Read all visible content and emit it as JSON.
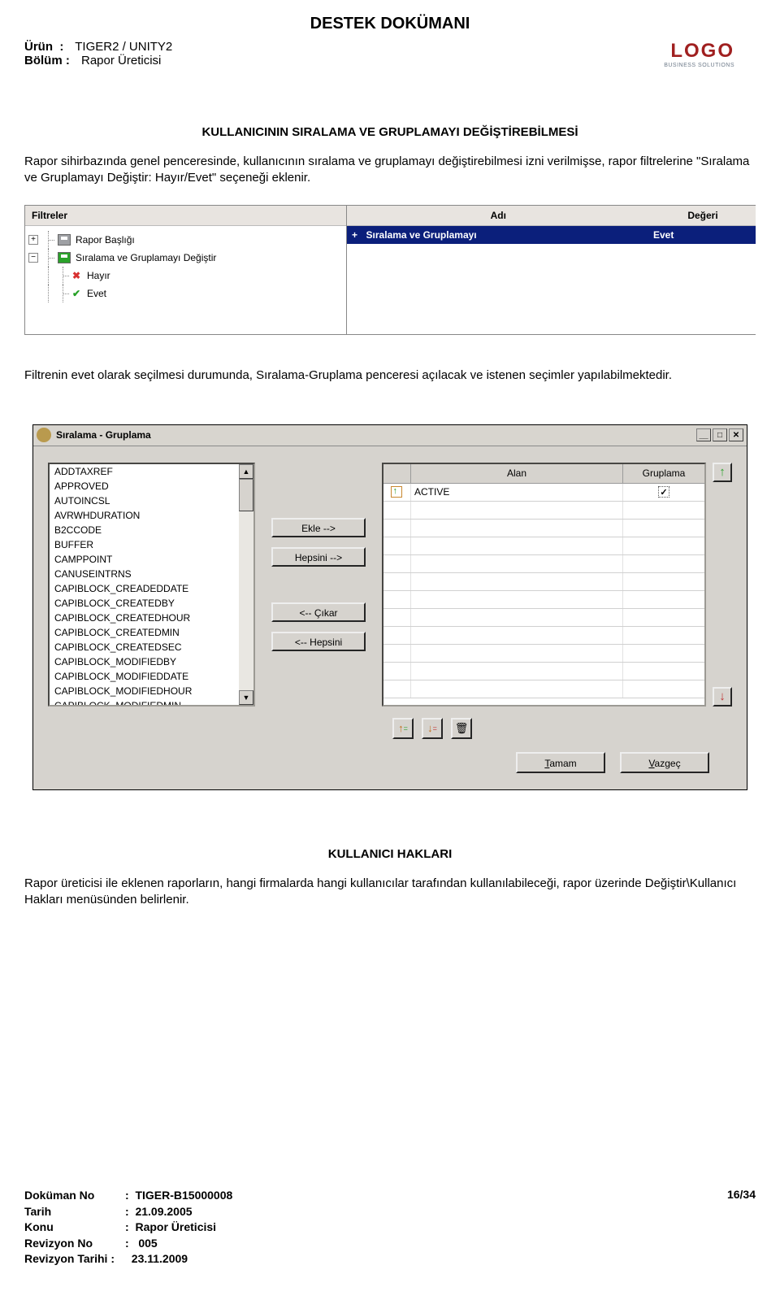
{
  "doc": {
    "title": "DESTEK DOKÜMANI",
    "product_label": "Ürün",
    "product_value": "TIGER2 / UNITY2",
    "section_label": "Bölüm :",
    "section_value": "Rapor Üreticisi",
    "logo": "LOGO",
    "logo_sub": "BUSINESS SOLUTIONS",
    "heading1": "KULLANICININ SIRALAMA VE GRUPLAMAYI DEĞİŞTİREBİLMESİ",
    "para1": "Rapor sihirbazında genel penceresinde, kullanıcının sıralama ve gruplamayı değiştirebilmesi izni verilmişse, rapor filtrelerine \"Sıralama ve Gruplamayı Değiştir: Hayır/Evet\" seçeneği eklenir.",
    "para2": "Filtrenin evet olarak seçilmesi durumunda, Sıralama-Gruplama penceresi açılacak ve istenen seçimler yapılabilmektedir.",
    "heading2": "KULLANICI HAKLARI",
    "para3": "Rapor üreticisi ile eklenen raporların, hangi firmalarda hangi kullanıcılar tarafından kullanılabileceği, rapor üzerinde Değiştir\\Kullanıcı Hakları menüsünden belirlenir."
  },
  "filter": {
    "left_header": "Filtreler",
    "right_header_name": "Adı",
    "right_header_value": "Değeri",
    "tree": {
      "item1": "Rapor Başlığı",
      "item2": "Sıralama ve Gruplamayı Değiştir",
      "opt_no": "Hayır",
      "opt_yes": "Evet"
    },
    "selected": {
      "name": "Sıralama ve Gruplamayı",
      "value": "Evet",
      "plus": "+"
    }
  },
  "dialog": {
    "title": "Sıralama - Gruplama",
    "fields": [
      "ADDTAXREF",
      "APPROVED",
      "AUTOINCSL",
      "AVRWHDURATION",
      "B2CCODE",
      "BUFFER",
      "CAMPPOINT",
      "CANUSEINTRNS",
      "CAPIBLOCK_CREADEDDATE",
      "CAPIBLOCK_CREATEDBY",
      "CAPIBLOCK_CREATEDHOUR",
      "CAPIBLOCK_CREATEDMIN",
      "CAPIBLOCK_CREATEDSEC",
      "CAPIBLOCK_MODIFIEDBY",
      "CAPIBLOCK_MODIFIEDDATE",
      "CAPIBLOCK_MODIFIEDHOUR",
      "CAPIBLOCK_MODIFIEDMIN"
    ],
    "buttons": {
      "add": "Ekle -->",
      "addall": "Hepsini -->",
      "remove": "<-- Çıkar",
      "removeall": "<-- Hepsini",
      "ok": "Tamam",
      "cancel": "Vazgeç"
    },
    "cols": {
      "alan": "Alan",
      "grup": "Gruplama"
    },
    "selected_row": {
      "field": "ACTIVE",
      "checked": true
    }
  },
  "footer": {
    "docno_label": "Doküman No",
    "docno": "TIGER-B15000008",
    "date_label": "Tarih",
    "date": "21.09.2005",
    "subject_label": "Konu",
    "subject": "Rapor Üreticisi",
    "revno_label": "Revizyon No",
    "revno": "005",
    "revdate_label": "Revizyon Tarihi :",
    "revdate": "23.11.2009",
    "page": "16/34"
  }
}
